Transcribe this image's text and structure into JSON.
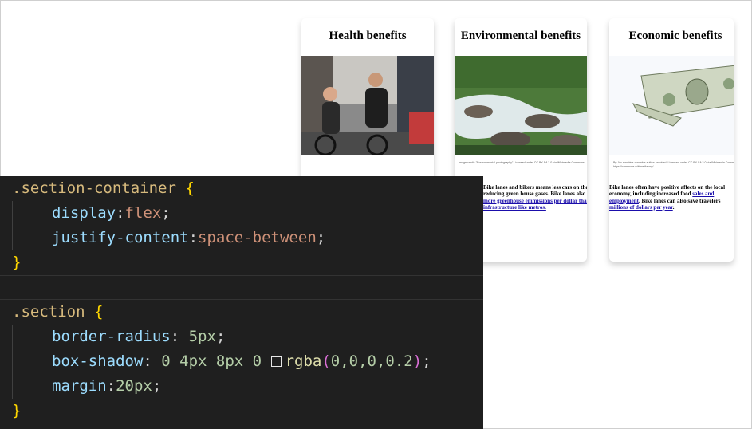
{
  "sections": [
    {
      "title": "Health benefits",
      "image_icon": "cyclists-photo",
      "caption": "",
      "body_parts": []
    },
    {
      "title": "Environmental benefits",
      "image_icon": "river-photo",
      "caption": "Image credit: \"Environmental photography\" Licensed under CC BY-SA 3.0 via Wikimedia Commons",
      "body_parts": [
        {
          "text": "Bike lanes and bikers means less cars on the road, reducing green house gases. Bike lanes also reduce ",
          "link": false
        },
        {
          "text": "more greenhouse emmissions per dollar than infrastructure like metros.",
          "link": true
        }
      ]
    },
    {
      "title": "Economic benefits",
      "image_icon": "dollar-bill-photo",
      "caption": "By: No machine-readable author provided. Licensed under CC BY-SA 3.0 via Wikimedia Commons https://commons.wikimedia.org/",
      "body_parts": [
        {
          "text": "Bike lanes often have positive affects on the local economy, including increased food ",
          "link": false
        },
        {
          "text": "sales and employment",
          "link": true
        },
        {
          "text": ". Bike lanes can also save travelers ",
          "link": false
        },
        {
          "text": "millions of dollars per year",
          "link": true
        },
        {
          "text": ".",
          "link": false
        }
      ]
    }
  ],
  "code": {
    "block1": {
      "selector": ".section-container",
      "open": " {",
      "decl1_prop": "display",
      "decl1_colon": ":",
      "decl1_val": "flex",
      "decl1_semi": ";",
      "decl2_prop": "justify-content",
      "decl2_colon": ":",
      "decl2_val": "space-between",
      "decl2_semi": ";",
      "close": "}"
    },
    "block2": {
      "selector": ".section",
      "open": " {",
      "decl1_prop": "border-radius",
      "decl1_colon": ": ",
      "decl1_val": "5px",
      "decl1_semi": ";",
      "decl2_prop": "box-shadow",
      "decl2_colon": ": ",
      "decl2_val": "0 4px 8px 0 ",
      "decl2_fn": "rgba",
      "decl2_open": "(",
      "decl2_args": "0,0,0,0.2",
      "decl2_close": ")",
      "decl2_semi": ";",
      "decl3_prop": "margin",
      "decl3_colon": ":",
      "decl3_val": "20px",
      "decl3_semi": ";",
      "close": "}"
    }
  },
  "colors": {
    "editor_bg": "#1f1f1f",
    "selector": "#d7ba7d",
    "brace": "#ffd700",
    "property": "#9cdcfe",
    "value": "#ce9178",
    "number": "#b5cea8",
    "link": "#1a0dab"
  }
}
